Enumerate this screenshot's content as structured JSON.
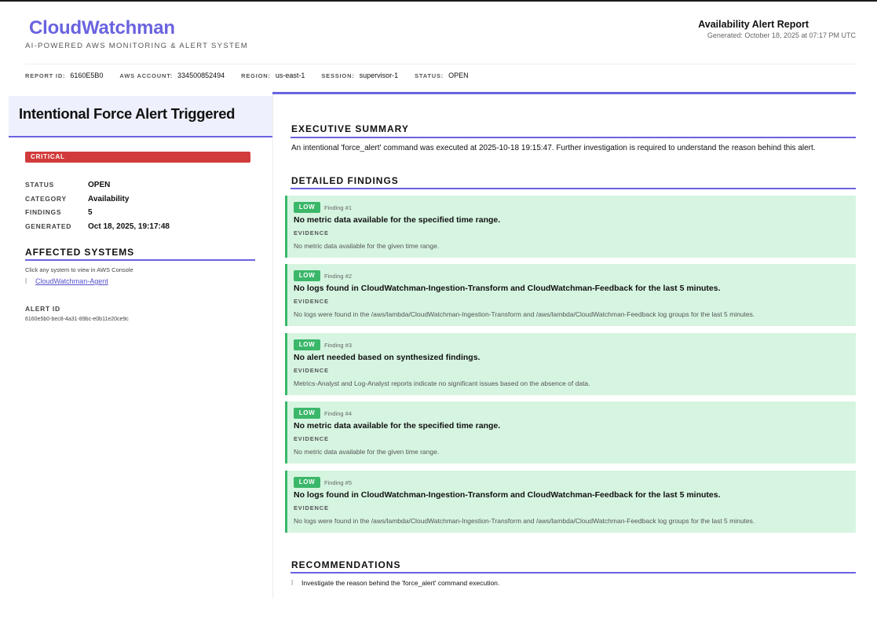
{
  "header": {
    "brand": "CloudWatchman",
    "tagline": "AI-POWERED AWS MONITORING & ALERT SYSTEM",
    "report_title": "Availability Alert Report",
    "generated": "Generated: October 18, 2025 at 07:17 PM UTC"
  },
  "meta": [
    {
      "key": "REPORT ID:",
      "value": "6160E5B0"
    },
    {
      "key": "AWS ACCOUNT:",
      "value": "334500852494"
    },
    {
      "key": "REGION:",
      "value": "us-east-1"
    },
    {
      "key": "SESSION:",
      "value": "supervisor-1"
    },
    {
      "key": "STATUS:",
      "value": "OPEN"
    }
  ],
  "incident": {
    "title": "Intentional Force Alert Triggered",
    "severity": "CRITICAL",
    "severity_color": "#d23b3b",
    "properties": [
      {
        "key": "STATUS",
        "value": "OPEN"
      },
      {
        "key": "CATEGORY",
        "value": "Availability"
      },
      {
        "key": "FINDINGS",
        "value": "5"
      },
      {
        "key": "GENERATED",
        "value": "Oct 18, 2025, 19:17:48"
      }
    ]
  },
  "affected": {
    "title": "AFFECTED SYSTEMS",
    "hint": "Click any system to view in AWS Console",
    "bullet": "Ï",
    "items": [
      "CloudWatchman-Agent"
    ]
  },
  "alert_id": {
    "label": "ALERT ID",
    "value": "6160e5b0-bec8-4a31-89bc-e0b11e20ce9c"
  },
  "summary": {
    "title": "EXECUTIVE SUMMARY",
    "text": "An intentional 'force_alert' command was executed at 2025-10-18 19:15:47. Further investigation is required to understand the reason behind this alert."
  },
  "findings": {
    "title": "DETAILED FINDINGS",
    "evidence_label": "EVIDENCE",
    "accent": "#3bb76a",
    "items": [
      {
        "severity": "LOW",
        "number": "Finding #1",
        "title": "No metric data available for the specified time range.",
        "evidence": "No metric data available for the given time range."
      },
      {
        "severity": "LOW",
        "number": "Finding #2",
        "title": "No logs found in CloudWatchman-Ingestion-Transform and CloudWatchman-Feedback for the last 5 minutes.",
        "evidence": "No logs were found in the /aws/lambda/CloudWatchman-Ingestion-Transform and /aws/lambda/CloudWatchman-Feedback log groups for the last 5 minutes."
      },
      {
        "severity": "LOW",
        "number": "Finding #3",
        "title": "No alert needed based on synthesized findings.",
        "evidence": "Metrics-Analyst and Log-Analyst reports indicate no significant issues based on the absence of data."
      },
      {
        "severity": "LOW",
        "number": "Finding #4",
        "title": "No metric data available for the specified time range.",
        "evidence": "No metric data available for the given time range."
      },
      {
        "severity": "LOW",
        "number": "Finding #5",
        "title": "No logs found in CloudWatchman-Ingestion-Transform and CloudWatchman-Feedback for the last 5 minutes.",
        "evidence": "No logs were found in the /aws/lambda/CloudWatchman-Ingestion-Transform and /aws/lambda/CloudWatchman-Feedback log groups for the last 5 minutes."
      }
    ]
  },
  "recommendations": {
    "title": "RECOMMENDATIONS",
    "bullet": "Ï",
    "items": [
      "Investigate the reason behind the 'force_alert' command execution."
    ]
  },
  "colors": {
    "brand": "#6a63e0",
    "critical": "#d23b3b",
    "low": "#3bb76a",
    "finding_bg": "#d6f5e1"
  }
}
